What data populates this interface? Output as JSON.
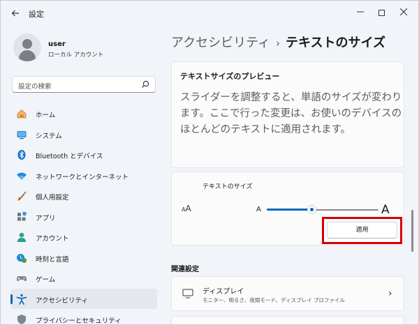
{
  "window": {
    "title": "設定",
    "back_icon": "arrow-left-icon",
    "minimize_icon": "minimize-icon",
    "maximize_icon": "maximize-icon",
    "close_icon": "close-icon"
  },
  "user": {
    "name": "user",
    "account_type": "ローカル アカウント"
  },
  "search": {
    "placeholder": "設定の検索",
    "icon": "search-icon"
  },
  "sidebar": {
    "items": [
      {
        "label": "ホーム",
        "icon": "home-icon"
      },
      {
        "label": "システム",
        "icon": "system-icon"
      },
      {
        "label": "Bluetooth とデバイス",
        "icon": "bluetooth-icon"
      },
      {
        "label": "ネットワークとインターネット",
        "icon": "wifi-icon"
      },
      {
        "label": "個人用設定",
        "icon": "brush-icon"
      },
      {
        "label": "アプリ",
        "icon": "apps-icon"
      },
      {
        "label": "アカウント",
        "icon": "account-icon"
      },
      {
        "label": "時刻と言語",
        "icon": "time-language-icon"
      },
      {
        "label": "ゲーム",
        "icon": "game-icon"
      },
      {
        "label": "アクセシビリティ",
        "icon": "accessibility-icon",
        "active": true
      },
      {
        "label": "プライバシーとセキュリティ",
        "icon": "shield-icon"
      }
    ]
  },
  "breadcrumb": {
    "parent": "アクセシビリティ",
    "separator": "›",
    "current": "テキストのサイズ"
  },
  "preview": {
    "title": "テキストサイズのプレビュー",
    "text": "スライダーを調整すると、単語のサイズが変わります。ここで行った変更は、お使いのデバイスのほとんどのテキストに適用されます。"
  },
  "text_size": {
    "label": "テキストのサイズ",
    "icon_text_big": "A",
    "icon_text_small": "A",
    "slider_min_label": "A",
    "slider_max_label": "A",
    "slider_value_fraction": 0.4,
    "apply_label": "適用",
    "accent_color": "#0067c0",
    "highlight_color": "#d60000"
  },
  "related": {
    "heading": "関連設定",
    "display": {
      "title": "ディスプレイ",
      "subtitle": "モニター、明るさ、夜間モード、ディスプレイ プロファイル",
      "icon": "monitor-icon",
      "chevron": "›"
    }
  }
}
